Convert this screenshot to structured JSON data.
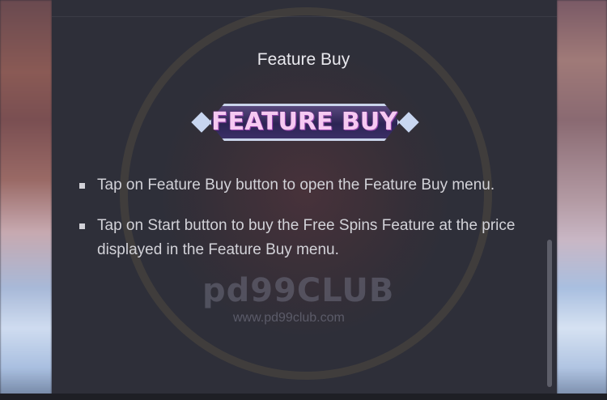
{
  "title": "Feature Buy",
  "badge": {
    "text": "FEATURE BUY"
  },
  "bullets": [
    "Tap on Feature Buy button to open the Feature Buy menu.",
    "Tap on Start button to buy the Free Spins Feature at the price displayed in the Feature Buy menu."
  ],
  "watermark": {
    "logo": "pd99CLUB",
    "url": "www.pd99club.com"
  },
  "colors": {
    "panel": "#2e2f39",
    "text": "#d2d2d8",
    "title": "#e9e9ee",
    "badge_text": "#f6c9f2"
  }
}
